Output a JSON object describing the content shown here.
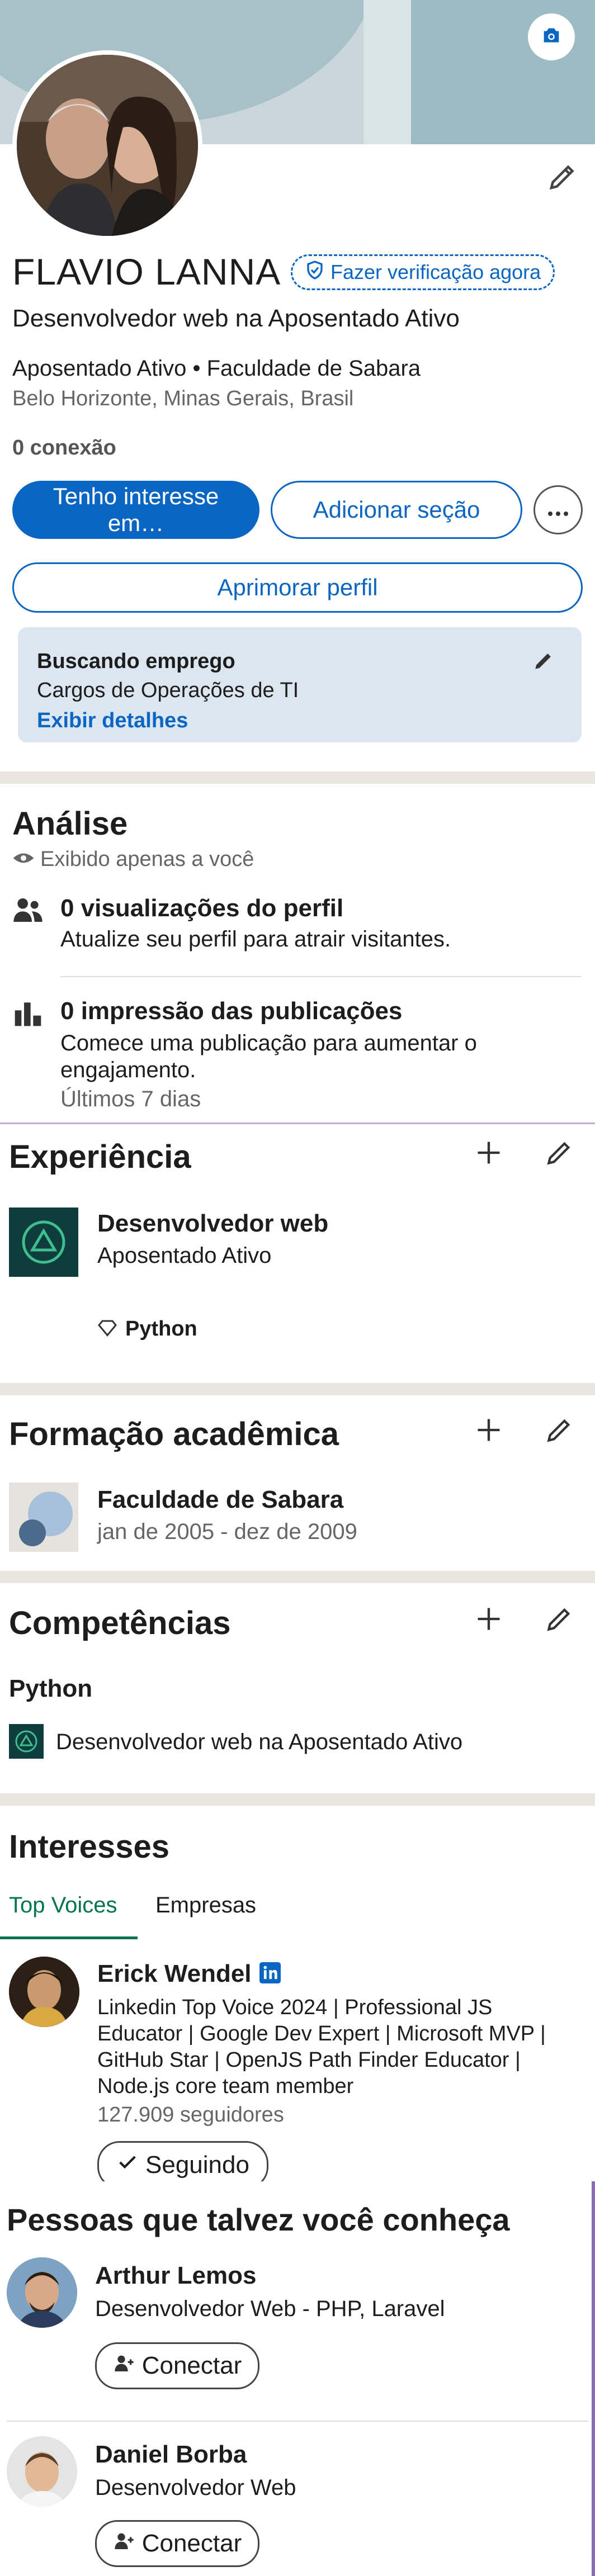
{
  "profile": {
    "name": "FLAVIO LANNA",
    "verify_label": "Fazer verificação agora",
    "headline": "Desenvolvedor web na Aposentado Ativo",
    "org_line": "Aposentado Ativo • Faculdade de Sabara",
    "location": "Belo Horizonte, Minas Gerais, Brasil",
    "connections": "0 conexão"
  },
  "actions": {
    "primary": "Tenho interesse em…",
    "add_section": "Adicionar seção",
    "improve": "Aprimorar perfil"
  },
  "job_seeking": {
    "title": "Buscando emprego",
    "roles": "Cargos de Operações de TI",
    "details_link": "Exibir detalhes"
  },
  "analytics": {
    "title": "Análise",
    "visibility": "Exibido apenas a você",
    "views_title": "0 visualizações do perfil",
    "views_sub": "Atualize seu perfil para atrair visitantes.",
    "impressions_title": "0 impressão das publicações",
    "impressions_sub": "Comece uma publicação para aumentar o engajamento.",
    "period": "Últimos 7 dias"
  },
  "experience": {
    "title": "Experiência",
    "role": "Desenvolvedor web",
    "company": "Aposentado Ativo",
    "skill": "Python"
  },
  "education": {
    "title": "Formação acadêmica",
    "school": "Faculdade de Sabara",
    "dates": "jan de 2005 - dez de 2009"
  },
  "skills": {
    "title": "Competências",
    "skill": "Python",
    "context": "Desenvolvedor web na Aposentado Ativo"
  },
  "interests": {
    "title": "Interesses",
    "tabs": [
      "Top Voices",
      "Empresas"
    ],
    "person": {
      "name": "Erick Wendel",
      "bio": "Linkedin Top Voice 2024 | Professional JS Educator | Google Dev Expert | Microsoft MVP | GitHub Star | OpenJS Path Finder Educator | Node.js core team member",
      "followers": "127.909 seguidores",
      "follow_state": "Seguindo"
    }
  },
  "pymk": {
    "title": "Pessoas que talvez você conheça",
    "people": [
      {
        "name": "Arthur Lemos",
        "headline": "Desenvolvedor Web - PHP, Laravel",
        "action": "Conectar"
      },
      {
        "name": "Daniel Borba",
        "headline": "Desenvolvedor Web",
        "action": "Conectar"
      }
    ]
  },
  "colors": {
    "brand_blue": "#0a66c2",
    "green_accent": "#01754f",
    "card_bg": "#dce6f1",
    "divider": "#e9e5df"
  }
}
